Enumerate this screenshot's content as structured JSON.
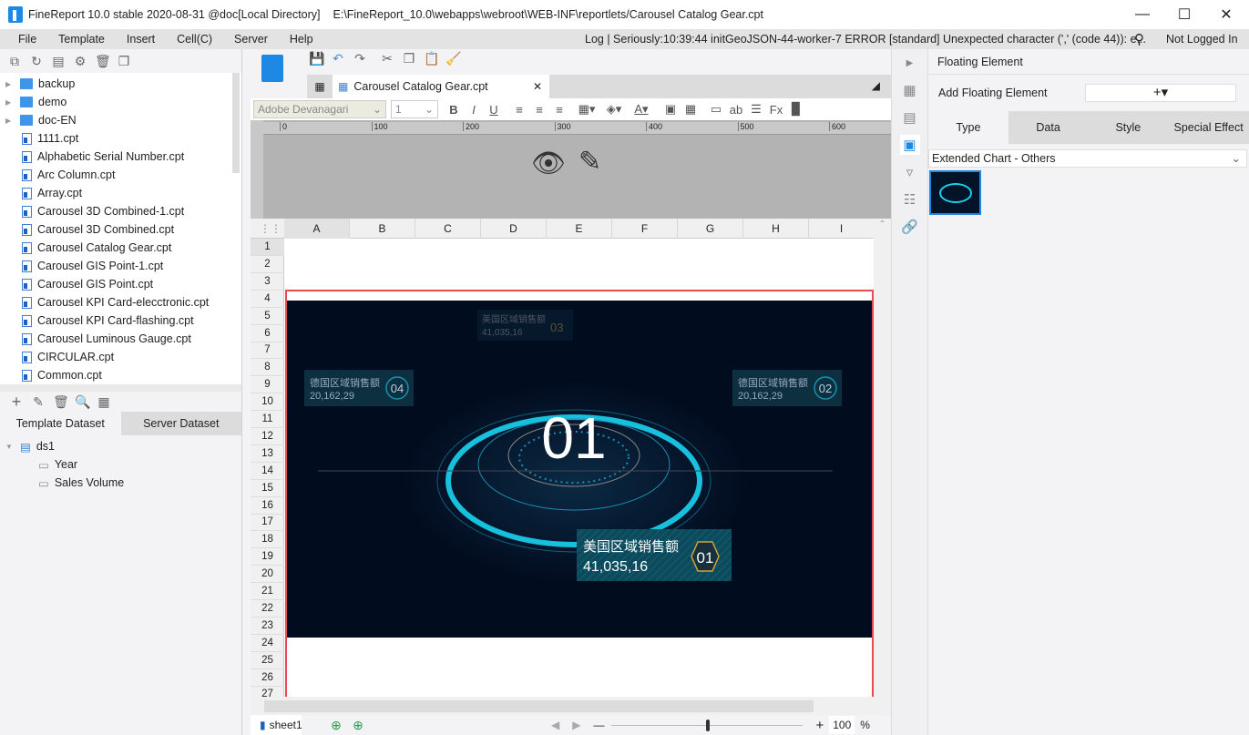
{
  "window": {
    "title": "FineReport 10.0 stable 2020-08-31 @doc[Local Directory]",
    "path": "E:\\FineReport_10.0\\webapps\\webroot\\WEB-INF\\reportlets/Carousel Catalog Gear.cpt",
    "minimize": "—",
    "maximize": "☐",
    "close": "✕"
  },
  "menu": {
    "items": [
      "File",
      "Template",
      "Insert",
      "Cell(C)",
      "Server",
      "Help"
    ],
    "log": "Log | Seriously:10:39:44 initGeoJSON-44-worker-7 ERROR [standard] Unexpected character (',' (code 44)): e...",
    "login": "Not Logged In"
  },
  "tree": {
    "folders": [
      "backup",
      "demo",
      "doc-EN"
    ],
    "files": [
      "1111.cpt",
      "Alphabetic Serial Number.cpt",
      "Arc Column.cpt",
      "Array.cpt",
      "Carousel 3D Combined-1.cpt",
      "Carousel 3D Combined.cpt",
      "Carousel Catalog Gear.cpt",
      "Carousel GIS Point-1.cpt",
      "Carousel GIS Point.cpt",
      "Carousel KPI Card-elecctronic.cpt",
      "Carousel KPI Card-flashing.cpt",
      "Carousel Luminous Gauge.cpt",
      "CIRCULAR.cpt",
      "Common.cpt"
    ]
  },
  "dataset": {
    "tabs": [
      "Template Dataset",
      "Server Dataset"
    ],
    "ds": "ds1",
    "fields": [
      "Year",
      "Sales Volume"
    ]
  },
  "editor": {
    "tab": "Carousel Catalog Gear.cpt",
    "font": "Adobe Devanagari",
    "size": "1",
    "ruler": [
      "0",
      "100",
      "200",
      "300",
      "400",
      "500",
      "600"
    ],
    "columns": [
      "A",
      "B",
      "C",
      "D",
      "E",
      "F",
      "G",
      "H",
      "I"
    ],
    "rows": [
      "1",
      "2",
      "3",
      "4",
      "5",
      "6",
      "7",
      "8",
      "9",
      "10",
      "11",
      "12",
      "13",
      "14",
      "15",
      "16",
      "17",
      "18",
      "19",
      "20",
      "21",
      "22",
      "23",
      "24",
      "25",
      "26",
      "27"
    ],
    "sheet": "sheet1",
    "zoom": "100",
    "zoom_unit": "%",
    "zoom_level": 100
  },
  "chart": {
    "center_number": "01",
    "cards": [
      {
        "title": "美国区域销售额",
        "value": "41,035,16",
        "num": "03"
      },
      {
        "title": "德国区域销售额",
        "value": "20,162,29",
        "num": "04"
      },
      {
        "title": "德国区域销售额",
        "value": "20,162,29",
        "num": "02"
      },
      {
        "title": "美国区域销售额",
        "value": "41,035,16",
        "num": "01"
      }
    ]
  },
  "panel": {
    "title": "Floating Element",
    "add_label": "Add Floating Element",
    "add_icon": "+▾",
    "tabs": [
      "Type",
      "Data",
      "Style",
      "Special Effect"
    ],
    "select": "Extended Chart - Others"
  },
  "colors": {
    "selection": "#e84b4b",
    "accent": "#1e88e5",
    "chart_bg": "#020c1f",
    "glow": "#19d2f0"
  }
}
